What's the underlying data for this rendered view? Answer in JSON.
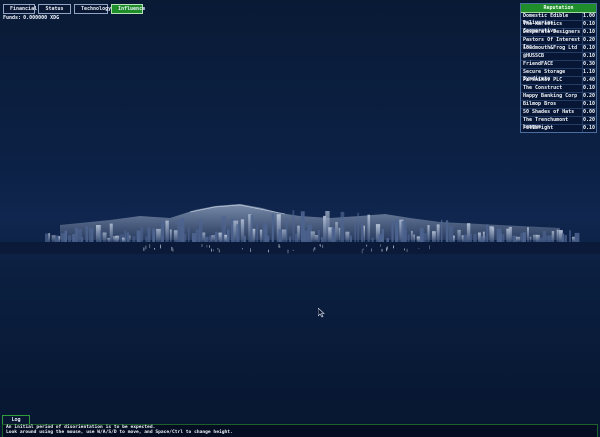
{
  "tabs": [
    {
      "label": "Financial",
      "active": false
    },
    {
      "label": "Status",
      "active": false
    },
    {
      "label": "Technology",
      "active": false
    },
    {
      "label": "Influence",
      "active": true
    }
  ],
  "funds": {
    "label": "Funds:",
    "value": "0.000000 XDG"
  },
  "reputation": {
    "title": "Reputation",
    "rows": [
      {
        "name": "Domestic Edible Deliveries",
        "value": "1.00"
      },
      {
        "name": "The Narcotics Cooperative",
        "value": "0.10"
      },
      {
        "name": "Desperate Designers",
        "value": "0.10"
      },
      {
        "name": "Pastors Of Interest Inc",
        "value": "0.20"
      },
      {
        "name": "Loudmouth&Frog Ltd",
        "value": "0.10"
      },
      {
        "name": "@HUSSCB",
        "value": "0.10"
      },
      {
        "name": "FriendFACE",
        "value": "0.30"
      },
      {
        "name": "Secure Storage Syndicate",
        "value": "1.10"
      },
      {
        "name": "Parsnikov PLC",
        "value": "0.40"
      },
      {
        "name": "The Construct",
        "value": "0.10"
      },
      {
        "name": "Happy Banking Corp",
        "value": "0.20"
      },
      {
        "name": "Bilmop Bros",
        "value": "0.10"
      },
      {
        "name": "50 Shades of Hats",
        "value": "0.00"
      },
      {
        "name": "The Trenchumont League",
        "value": "0.20"
      },
      {
        "name": "Fullbright",
        "value": "0.10"
      }
    ]
  },
  "log": {
    "tab_label": "Log",
    "lines": [
      "An initial period of disorientation is to be expected.",
      "Look around using the mouse, use W/A/S/D to move, and Space/Ctrl to change height."
    ]
  },
  "colors": {
    "accent_green": "#1f8d2a",
    "sky": "#0c2146",
    "panel": "#071634"
  }
}
